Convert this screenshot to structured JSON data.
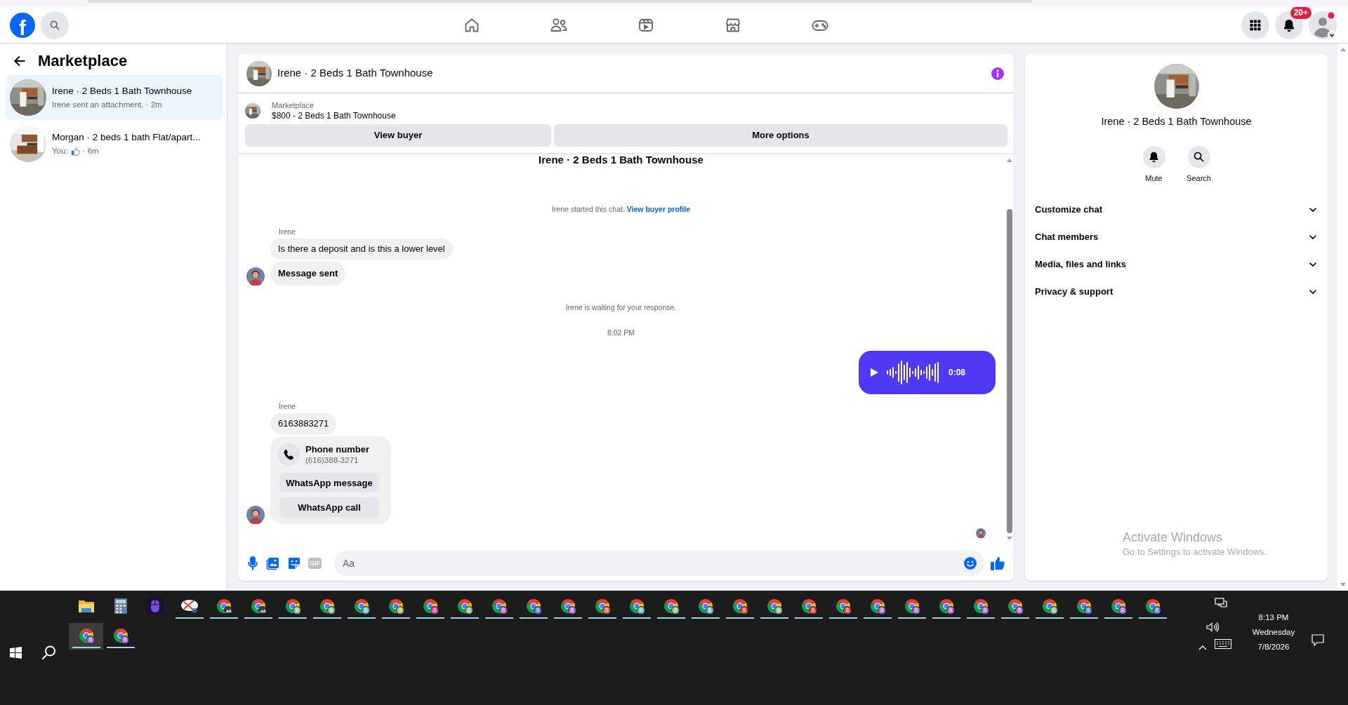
{
  "logo": "f",
  "nav": {
    "notification_count": "20+"
  },
  "sidebar": {
    "title": "Marketplace",
    "conversations": [
      {
        "title": "Irene · 2 Beds 1 Bath Townhouse",
        "preview": [
          {
            "kind": "text",
            "text": "Irene sent an attachment. · 2m"
          }
        ],
        "selected": true
      },
      {
        "title": "Morgan · 2 beds 1 bath Flat/apart...",
        "preview": [
          {
            "kind": "text",
            "text": "You:"
          },
          {
            "kind": "like"
          },
          {
            "kind": "text",
            "text": "· 6m"
          }
        ],
        "selected": false
      }
    ]
  },
  "chat": {
    "title": "Irene · 2 Beds 1 Bath Townhouse",
    "listing": {
      "label": "Marketplace",
      "title": "$800 - 2 Beds 1 Bath Townhouse"
    },
    "buttons": [
      "View buyer",
      "More options"
    ],
    "messages": [
      {
        "kind": "heading",
        "text": "Irene · 2 Beds 1 Bath Townhouse"
      },
      {
        "kind": "system",
        "text": "Irene started this chat.",
        "link": "View buyer profile"
      },
      {
        "kind": "sender",
        "text": "Irene"
      },
      {
        "kind": "bubble",
        "text": "Is there a deposit and is this a lower level",
        "bold": false,
        "avatar": false
      },
      {
        "kind": "bubble",
        "text": "Message sent",
        "bold": true,
        "avatar": true
      },
      {
        "kind": "system",
        "text": "Irene is waiting for your response."
      },
      {
        "kind": "time",
        "text": "8:02 PM"
      },
      {
        "kind": "voice",
        "duration": "0:08"
      },
      {
        "kind": "sender",
        "text": "Irene"
      },
      {
        "kind": "bubble",
        "text": "6163883271",
        "bold": false,
        "avatar": false
      },
      {
        "kind": "contact",
        "title": "Phone number",
        "number": "(616)388-3271",
        "buttons": [
          "WhatsApp message",
          "WhatsApp call"
        ],
        "avatar": true
      },
      {
        "kind": "seen"
      }
    ],
    "composer": {
      "gif": "GIF",
      "placeholder": "Aa"
    }
  },
  "info": {
    "title": "Irene · 2 Beds 1 Bath Townhouse",
    "actions": [
      {
        "kind": "bell",
        "label": "Mute"
      },
      {
        "kind": "search",
        "label": "Search"
      }
    ],
    "sections": [
      {
        "label": "Customize chat",
        "expanded": false
      },
      {
        "label": "Chat members",
        "expanded": false
      },
      {
        "label": "Media, files and links",
        "expanded": false
      },
      {
        "label": "Privacy & support",
        "expanded": false
      }
    ]
  },
  "activation": {
    "title": "Activate Windows",
    "subtitle": "Go to Settings to activate Windows."
  },
  "taskbar": {
    "rows": [
      [
        {
          "kind": "folder",
          "running": false,
          "selected": false
        },
        {
          "kind": "calculator",
          "running": false,
          "selected": false
        },
        {
          "kind": "mouse-app",
          "running": false,
          "selected": false
        },
        {
          "kind": "snipping",
          "running": true,
          "selected": false
        },
        {
          "kind": "browser-photo",
          "running": true,
          "selected": false
        },
        {
          "kind": "browser-photo",
          "running": true,
          "selected": false
        },
        {
          "kind": "browser",
          "color": "#8fbc8f",
          "running": true,
          "selected": false
        },
        {
          "kind": "browser",
          "color": "#8fbc8f",
          "running": true,
          "selected": false
        },
        {
          "kind": "browser",
          "color": "#6fb7c9",
          "running": true,
          "selected": false
        },
        {
          "kind": "browser",
          "color": "#b5b56a",
          "running": true,
          "selected": false
        },
        {
          "kind": "browser",
          "color": "#e0409a",
          "running": true,
          "selected": false
        },
        {
          "kind": "browser",
          "color": "#8fbc8f",
          "running": true,
          "selected": false
        },
        {
          "kind": "browser",
          "color": "#a865e0",
          "running": true,
          "selected": false
        },
        {
          "kind": "browser",
          "color": "#4a7de0",
          "running": true,
          "selected": false
        },
        {
          "kind": "browser",
          "color": "#a865e0",
          "running": true,
          "selected": false
        },
        {
          "kind": "browser",
          "color": "#e8603c",
          "running": true,
          "selected": false
        },
        {
          "kind": "browser",
          "color": "#6fb7c9",
          "running": true,
          "selected": false
        },
        {
          "kind": "browser",
          "color": "#8fbc8f",
          "running": true,
          "selected": false
        },
        {
          "kind": "browser",
          "color": "#6fb7c9",
          "running": true,
          "selected": false
        },
        {
          "kind": "browser",
          "color": "#e84040",
          "running": true,
          "selected": false
        },
        {
          "kind": "browser",
          "color": "#8fbc8f",
          "running": true,
          "selected": false
        },
        {
          "kind": "browser",
          "color": "#e84040",
          "running": true,
          "selected": false
        },
        {
          "kind": "browser",
          "color": "#e84040",
          "running": true,
          "selected": false
        },
        {
          "kind": "browser",
          "color": "#a865e0",
          "running": true,
          "selected": false
        },
        {
          "kind": "browser",
          "color": "#a865e0",
          "running": true,
          "selected": false
        },
        {
          "kind": "browser",
          "color": "#a865e0",
          "running": true,
          "selected": false
        },
        {
          "kind": "browser",
          "color": "#a865e0",
          "running": true,
          "selected": false
        },
        {
          "kind": "browser",
          "color": "#a865e0",
          "running": true,
          "selected": false
        },
        {
          "kind": "browser",
          "color": "#8fbc8f",
          "running": true,
          "selected": false
        },
        {
          "kind": "browser",
          "color": "#4a7de0",
          "running": true,
          "selected": false
        },
        {
          "kind": "browser",
          "color": "#a865e0",
          "running": true,
          "selected": false
        },
        {
          "kind": "browser",
          "color": "#4a7de0",
          "running": true,
          "selected": false
        }
      ],
      [
        {
          "kind": "browser",
          "color": "#a865e0",
          "running": true,
          "selected": true
        },
        {
          "kind": "browser",
          "color": "#a865e0",
          "running": true,
          "selected": false
        }
      ]
    ],
    "clock": {
      "time": "8:13 PM",
      "day": "Wednesday",
      "date": "7/8/2026"
    }
  }
}
